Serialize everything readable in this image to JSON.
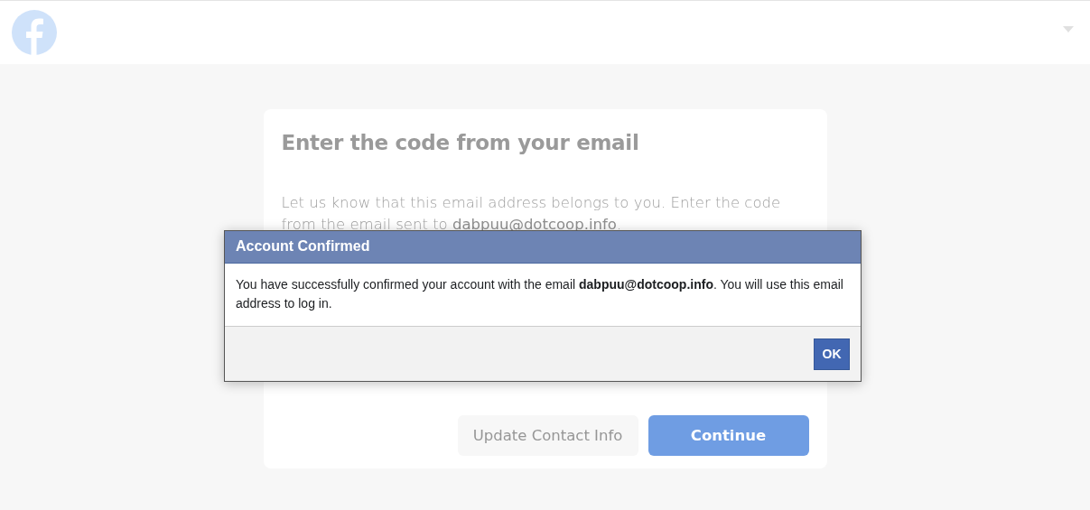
{
  "card": {
    "title": "Enter the code from your email",
    "description": "Let us know that this email address belongs to you. Enter the code from the email sent to **dabpuu@dotcoop.info**.",
    "buttons": [
      {
        "label": "Update Contact Info",
        "kind": "secondary"
      },
      {
        "label": "Continue",
        "kind": "primary"
      }
    ]
  },
  "dialog": {
    "title": "Account Confirmed",
    "message": "You have successfully confirmed your account with the email **dabpuu@dotcoop.info**. You will use this email address to log in.",
    "button": "OK"
  }
}
